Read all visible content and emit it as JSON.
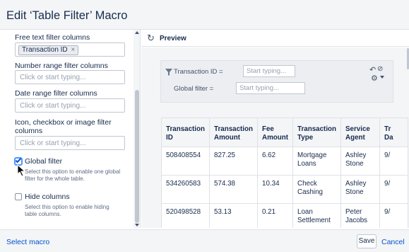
{
  "dialog": {
    "title": "Edit ‘Table Filter’ Macro"
  },
  "form": {
    "free_text": {
      "label": "Free text filter columns",
      "tag": "Transaction ID",
      "tag_remove": "×"
    },
    "number_range": {
      "label": "Number range filter columns",
      "placeholder": "Click or start typing..."
    },
    "date_range": {
      "label": "Date range filter columns",
      "placeholder": "Click or start typing..."
    },
    "icon_filter": {
      "label_line1": "Icon, checkbox or image filter",
      "label_line2": "columns",
      "placeholder": "Click or start typing..."
    },
    "global_filter": {
      "label": "Global filter",
      "checked": true,
      "desc_line1": "Select this option to enable one global",
      "desc_line2": "filter for the whole table."
    },
    "hide_columns": {
      "label": "Hide columns",
      "checked": false,
      "desc_line1": "Select this option to enable hiding",
      "desc_line2": "table columns."
    }
  },
  "preview": {
    "label": "Preview",
    "filter": {
      "transaction_label": "Transaction ID =",
      "transaction_placeholder": "Start typing...",
      "global_label": "Global filter =",
      "global_placeholder": "Start typing..."
    },
    "table": {
      "headers": [
        [
          "Transaction",
          "ID"
        ],
        [
          "Transaction",
          "Amount"
        ],
        [
          "Fee",
          "Amount"
        ],
        [
          "Transaction",
          "Type"
        ],
        [
          "Service",
          "Agent"
        ],
        [
          "Tr",
          "Da"
        ]
      ],
      "rows": [
        [
          [
            "508408554"
          ],
          [
            "827.25"
          ],
          [
            "6.62"
          ],
          [
            "Mortgage",
            "Loans"
          ],
          [
            "Ashley",
            "Stone"
          ],
          [
            "9/"
          ]
        ],
        [
          [
            "534260583"
          ],
          [
            "574.38"
          ],
          [
            "10.34"
          ],
          [
            "Check",
            "Cashing"
          ],
          [
            "Ashley",
            "Stone"
          ],
          [
            "9/"
          ]
        ],
        [
          [
            "520498528"
          ],
          [
            "53.13"
          ],
          [
            "0.21"
          ],
          [
            "Loan",
            "Settlement"
          ],
          [
            "Peter",
            "Jacobs"
          ],
          [
            "9/"
          ]
        ]
      ]
    }
  },
  "footer": {
    "select_macro": "Select macro",
    "save": "Save",
    "cancel": "Cancel"
  },
  "colors": {
    "link": "#0052cc",
    "header_bg": "#f4f5f7",
    "border": "#dfe1e6",
    "check_accent": "#4c9aff"
  },
  "icons": [
    "refresh-icon",
    "filter-icon",
    "undo-icon",
    "block-icon",
    "cog-icon",
    "cursor-icon"
  ]
}
